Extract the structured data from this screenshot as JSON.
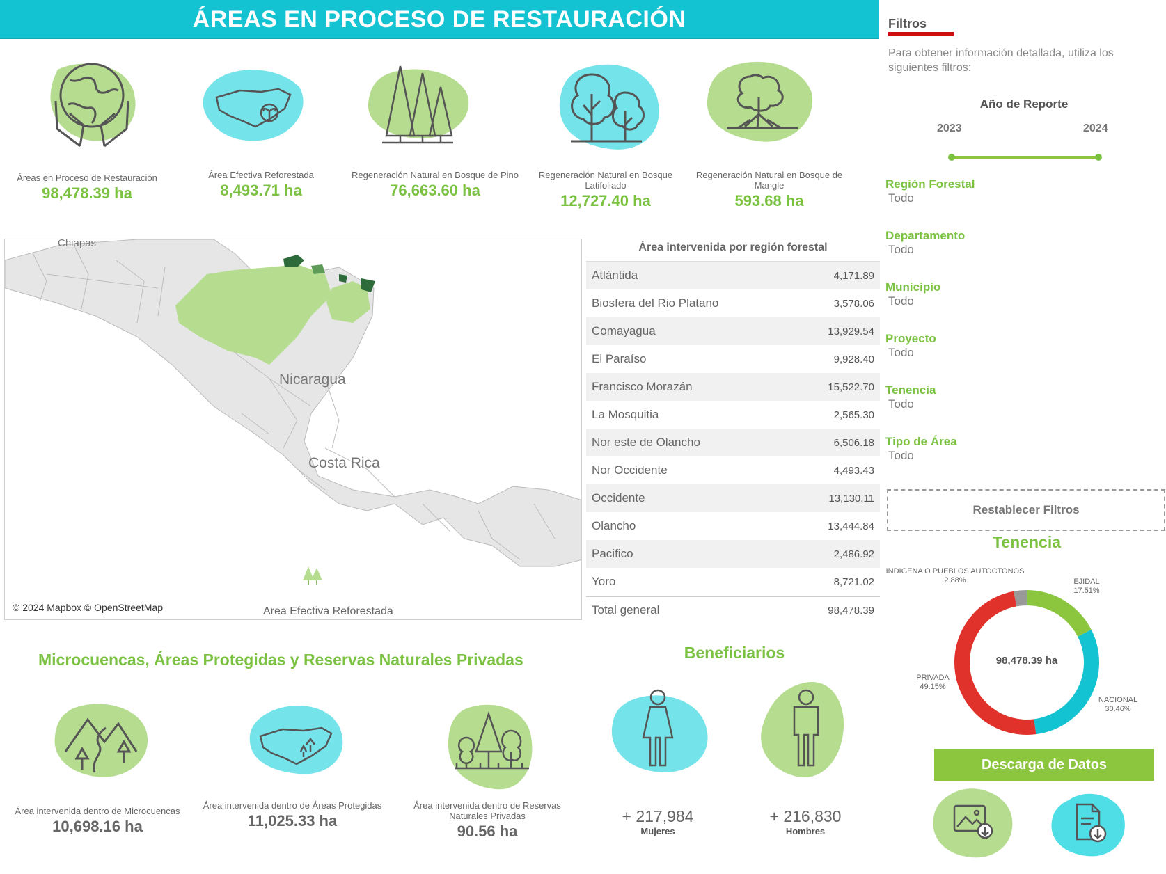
{
  "header": {
    "title": "ÁREAS EN PROCESO DE RESTAURACIÓN"
  },
  "colors": {
    "teal": "#14c3d1",
    "green": "#7cc242",
    "light_green": "#b5dc8f",
    "light_teal": "#74e3ea",
    "red": "#e0322a",
    "gray": "#999999"
  },
  "kpis": [
    {
      "icon": "earth-hands-icon",
      "label": "Áreas en Proceso de Restauración",
      "value": "98,478.39 ha"
    },
    {
      "icon": "honduras-map-plant-icon",
      "label": "Área Efectiva Reforestada",
      "value": "8,493.71 ha"
    },
    {
      "icon": "pine-trees-icon",
      "label": "Regeneración Natural en Bosque de Pino",
      "value": "76,663.60 ha"
    },
    {
      "icon": "broadleaf-trees-icon",
      "label": "Regeneración Natural en Bosque Latifoliado",
      "value": "12,727.40 ha"
    },
    {
      "icon": "mangrove-tree-icon",
      "label": "Regeneración Natural en Bosque de Mangle",
      "value": "593.68 ha"
    }
  ],
  "map": {
    "labels": {
      "chiapas": "Chiapas",
      "nicaragua": "Nicaragua",
      "costa_rica": "Costa Rica"
    },
    "attribution": "© 2024 Mapbox © OpenStreetMap",
    "legend": "Area Efectiva Reforestada"
  },
  "table": {
    "title": "Área intervenida por región forestal",
    "rows": [
      {
        "name": "Atlántida",
        "value": "4,171.89"
      },
      {
        "name": "Biosfera del Rio Platano",
        "value": "3,578.06"
      },
      {
        "name": "Comayagua",
        "value": "13,929.54"
      },
      {
        "name": "El Paraíso",
        "value": "9,928.40"
      },
      {
        "name": "Francisco Morazán",
        "value": "15,522.70"
      },
      {
        "name": "La Mosquitia",
        "value": "2,565.30"
      },
      {
        "name": "Nor este de Olancho",
        "value": "6,506.18"
      },
      {
        "name": "Nor Occidente",
        "value": "4,493.43"
      },
      {
        "name": "Occidente",
        "value": "13,130.11"
      },
      {
        "name": "Olancho",
        "value": "13,444.84"
      },
      {
        "name": "Pacifico",
        "value": "2,486.92"
      },
      {
        "name": "Yoro",
        "value": "8,721.02"
      }
    ],
    "total": {
      "name": "Total general",
      "value": "98,478.39"
    }
  },
  "protected": {
    "title": "Microcuencas, Áreas Protegidas y Reservas Naturales Privadas",
    "items": [
      {
        "icon": "watershed-icon",
        "label": "Área intervenida dentro de Microcuencas",
        "value": "10,698.16 ha"
      },
      {
        "icon": "protected-area-icon",
        "label": "Área intervenida dentro de Áreas Protegidas",
        "value": "11,025.33 ha"
      },
      {
        "icon": "private-reserve-icon",
        "label": "Área intervenida dentro de Reservas Naturales Privadas",
        "value": "90.56 ha"
      }
    ]
  },
  "beneficiaries": {
    "title": "Beneficiarios",
    "women": {
      "icon": "woman-icon",
      "value": "+ 217,984",
      "label": "Mujeres"
    },
    "men": {
      "icon": "man-icon",
      "value": "+ 216,830",
      "label": "Hombres"
    }
  },
  "filters": {
    "title": "Filtros",
    "description": "Para obtener información detallada, utiliza los siguientes filtros:",
    "year": {
      "label": "Año de Reporte",
      "min": "2023",
      "max": "2024"
    },
    "items": [
      {
        "label": "Región Forestal",
        "value": "Todo"
      },
      {
        "label": "Departamento",
        "value": "Todo"
      },
      {
        "label": "Municipio",
        "value": "Todo"
      },
      {
        "label": "Proyecto",
        "value": "Todo"
      },
      {
        "label": "Tenencia",
        "value": "Todo"
      },
      {
        "label": "Tipo de Área",
        "value": "Todo"
      }
    ],
    "reset_label": "Restablecer Filtros"
  },
  "tenencia": {
    "title": "Tenencia",
    "center": "98,478.39 ha",
    "segments": [
      {
        "name": "EJIDAL",
        "pct": "17.51%",
        "value": 17.51,
        "color": "#8cc63f"
      },
      {
        "name": "NACIONAL",
        "pct": "30.46%",
        "value": 30.46,
        "color": "#14c3d1"
      },
      {
        "name": "PRIVADA",
        "pct": "49.15%",
        "value": 49.15,
        "color": "#e0322a"
      },
      {
        "name": "INDIGENA O PUEBLOS AUTOCTONOS",
        "pct": "2.88%",
        "value": 2.88,
        "color": "#999999"
      }
    ]
  },
  "download": {
    "label": "Descarga de Datos",
    "image_icon": "download-image-icon",
    "file_icon": "download-file-icon"
  }
}
